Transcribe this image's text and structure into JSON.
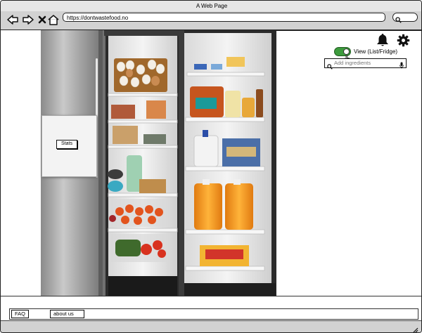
{
  "window": {
    "title": "A Web Page"
  },
  "browser": {
    "url": "https://dontwastefood.no",
    "icons": [
      "back-arrow-icon",
      "forward-arrow-icon",
      "close-icon",
      "home-icon",
      "search-icon"
    ]
  },
  "header": {
    "toggle_label": "View (List/Fridge)",
    "toggle_on": true,
    "search": {
      "placeholder": "Add ingredients",
      "value": ""
    },
    "icons": [
      "bell-icon",
      "gear-icon",
      "search-icon",
      "microphone-icon"
    ]
  },
  "fridge": {
    "stats_label": "Stats"
  },
  "footer": {
    "faq_label": "FAQ",
    "about_label": "about us"
  },
  "colors": {
    "toggle": "#3d9b3d",
    "chrome": "#d2d2d2"
  }
}
